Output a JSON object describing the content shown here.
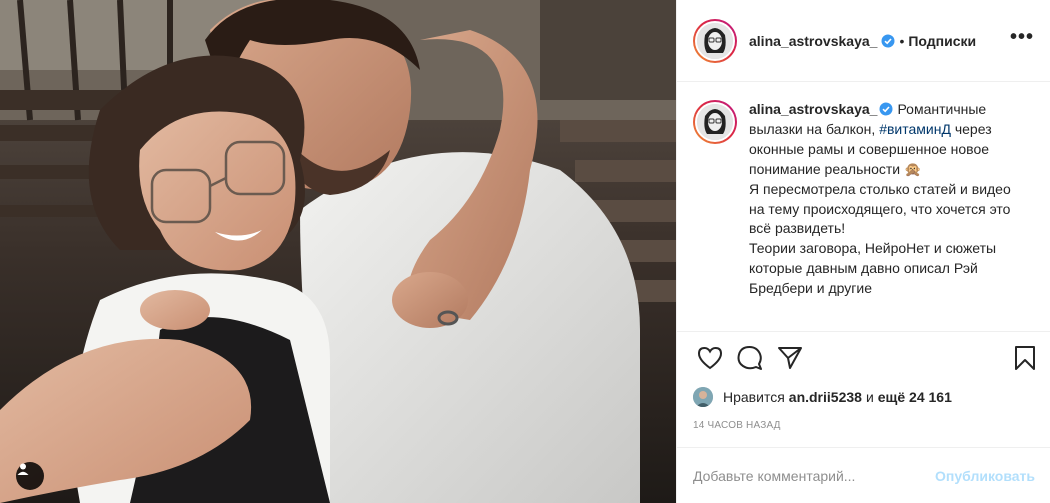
{
  "post": {
    "author": {
      "username": "alina_astrovskaya_",
      "verified": true,
      "verified_icon": "verified-badge-icon",
      "follow_status": "Подписки",
      "separator": "•"
    },
    "more_label": "•••",
    "caption": {
      "username": "alina_astrovskaya_",
      "text_before_tag": "Романтичные вылазки на балкон, ",
      "hashtag": "#витаминД",
      "text_after_tag": " через оконные рамы и совершенное новое понимание реальности 🙊",
      "line_2": "Я пересмотрела столько статей и видео на тему происходящего, что хочется это всё развидеть!",
      "line_3": "Теории заговора, НейроНет и сюжеты которые давным давно описал Рэй Бредбери и другие"
    },
    "actions": [
      "heart-icon",
      "comment-icon",
      "share-icon",
      "bookmark-icon"
    ],
    "likes": {
      "prefix": "Нравится",
      "liker": "an.drii5238",
      "conjunction": "и",
      "rest": "ещё 24 161"
    },
    "timestamp": "14 часов назад",
    "comment_box": {
      "placeholder": "Добавьте комментарий...",
      "publish_label": "Опубликовать"
    }
  },
  "colors": {
    "accent": "#0095f6",
    "publish_disabled": "#b2dffc",
    "hashtag": "#00376b",
    "muted": "#8e8e8e"
  }
}
